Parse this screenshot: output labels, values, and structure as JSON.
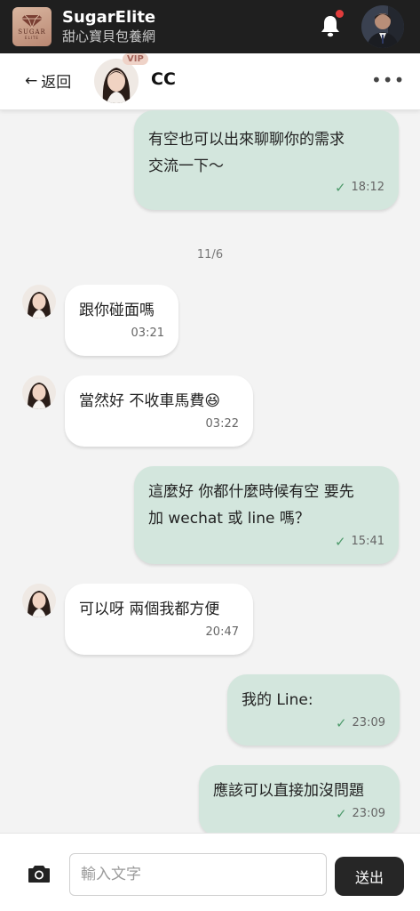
{
  "app": {
    "logo_text": "SUGAR",
    "logo_sub": "ELITE",
    "name": "SugarElite",
    "tagline": "甜心寶貝包養網"
  },
  "chat_header": {
    "back_label": "返回",
    "peer_name": "CC",
    "vip_badge": "VIP",
    "more_label": "•••"
  },
  "messages": [
    {
      "dir": "out",
      "text_lines": [
        "有空也可以出來聊聊你的需求",
        "交流一下～"
      ],
      "time": "18:12",
      "read": true
    },
    {
      "type": "date",
      "label": "11/6"
    },
    {
      "dir": "in",
      "text_lines": [
        "跟你碰面嗎"
      ],
      "time": "03:21"
    },
    {
      "dir": "in",
      "text_lines": [
        "當然好 不收車馬費😆"
      ],
      "time": "03:22"
    },
    {
      "dir": "out",
      "text_lines": [
        "這麼好 你都什麼時候有空 要先",
        "加 wechat 或 line 嗎？"
      ],
      "time": "15:41",
      "read": true
    },
    {
      "dir": "in",
      "text_lines": [
        "可以呀 兩個我都方便"
      ],
      "time": "20:47"
    },
    {
      "dir": "out",
      "text_lines": [
        "我的 Line:"
      ],
      "time": "23:09",
      "read": true
    },
    {
      "dir": "out",
      "text_lines": [
        "應該可以直接加沒問題"
      ],
      "time": "23:09",
      "read": true
    }
  ],
  "input": {
    "placeholder": "輸入文字",
    "value": "",
    "send_label": "送出"
  },
  "colors": {
    "appbar_bg": "#1f1f1f",
    "out_bubble": "#d3e6dd",
    "in_bubble": "#ffffff",
    "check": "#4e9a6b",
    "notification_dot": "#e13c3c"
  },
  "icons": {
    "bell": "bell-icon",
    "camera": "camera-icon",
    "back": "arrow-left-icon",
    "more": "more-horizontal-icon",
    "read": "check-icon"
  }
}
